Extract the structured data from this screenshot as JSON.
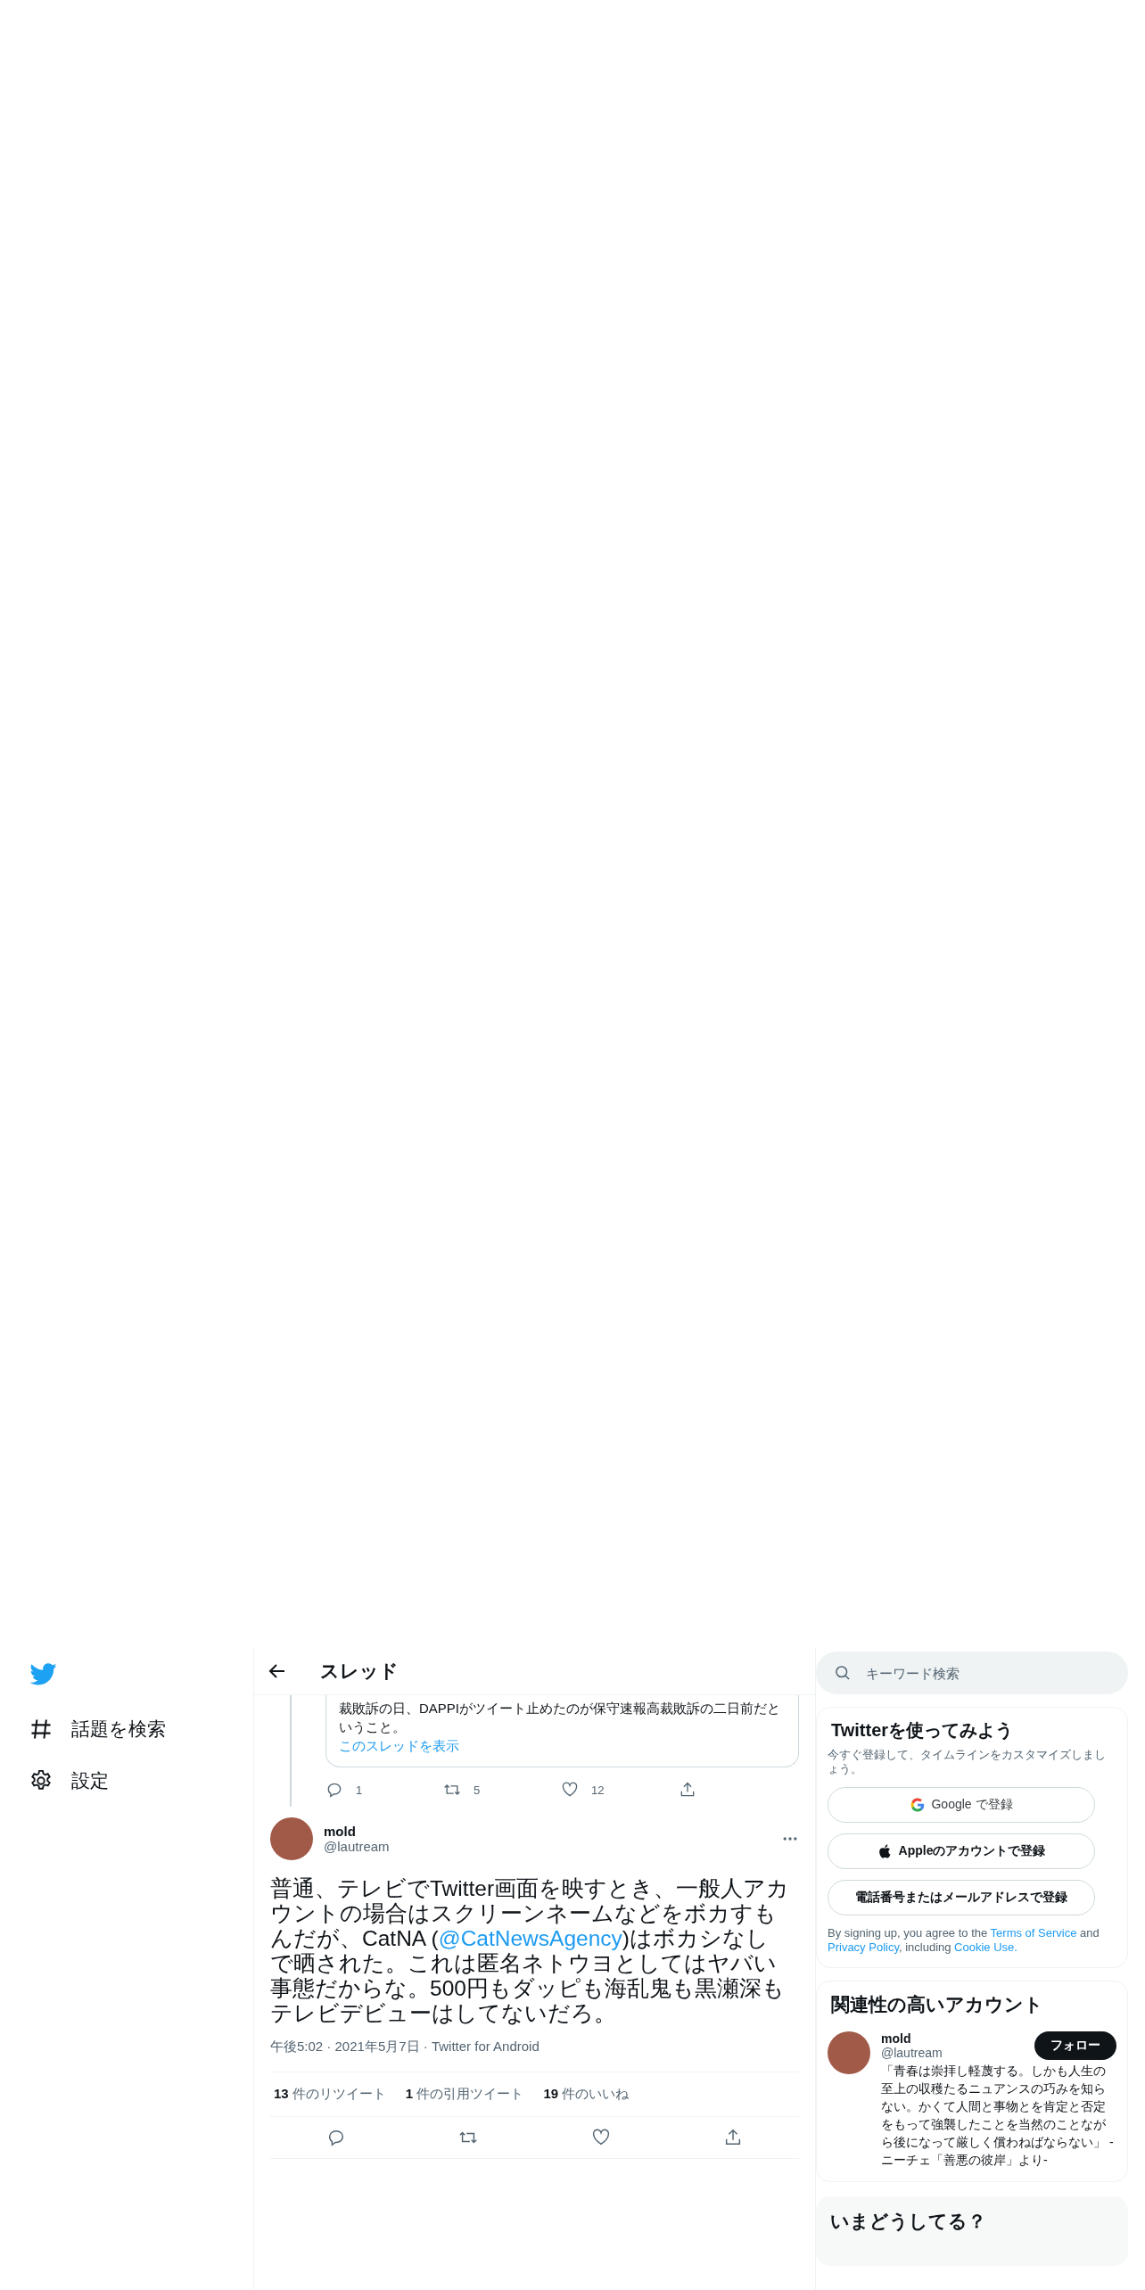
{
  "sidebar": {
    "items": [
      {
        "kind": "hashtag",
        "label": "話題を検索"
      },
      {
        "kind": "gear",
        "label": "設定"
      }
    ]
  },
  "header": {
    "title": "スレッド"
  },
  "quoted_card": {
    "text": "裁敗訴の日、DAPPIがツイート止めたのが保守速報高裁敗訴の二日前だということ。",
    "link": "このスレッドを表示"
  },
  "parent_actions": [
    {
      "kind": "reply",
      "count": "1"
    },
    {
      "kind": "retweet",
      "count": "5"
    },
    {
      "kind": "like",
      "count": "12"
    },
    {
      "kind": "share"
    }
  ],
  "tweet": {
    "name": "mold",
    "handle": "@lautream",
    "segments": [
      {
        "kind": "plain",
        "text": "普通、テレビでTwitter画面を映すとき、一般人アカウントの場合はスクリーンネームなどをボカすもんだが、CatNA ("
      },
      {
        "kind": "mention",
        "text": "@CatNewsAgency"
      },
      {
        "kind": "plain",
        "text": ")はボカシなしで晒された。これは匿名ネトウヨとしてはヤバい事態だからな。500円もダッピも海乱鬼も黒瀬深もテレビデビューはしてないだろ。"
      }
    ],
    "meta": "午後5:02 · 2021年5月7日 · Twitter for Android",
    "stats": [
      {
        "count": "13",
        "label": "件のリツイート"
      },
      {
        "count": "1",
        "label": "件の引用ツイート"
      },
      {
        "count": "19",
        "label": "件のいいね"
      }
    ],
    "actions": [
      {
        "kind": "reply"
      },
      {
        "kind": "retweet"
      },
      {
        "kind": "like"
      },
      {
        "kind": "share"
      }
    ]
  },
  "search": {
    "placeholder": "キーワード検索"
  },
  "signup": {
    "title": "Twitterを使ってみよう",
    "subtitle": "今すぐ登録して、タイムラインをカスタマイズしましょう。",
    "buttons": [
      {
        "kind": "google",
        "label": "Google で登録"
      },
      {
        "kind": "apple",
        "label": "Appleのアカウントで登録"
      },
      {
        "kind": "plain",
        "label": "電話番号またはメールアドレスで登録"
      }
    ],
    "legal": [
      {
        "kind": "plain",
        "text": "By signing up, you agree to the "
      },
      {
        "kind": "link",
        "text": "Terms of Service"
      },
      {
        "kind": "plain",
        "text": " and "
      },
      {
        "kind": "link",
        "text": "Privacy Policy"
      },
      {
        "kind": "plain",
        "text": ", including "
      },
      {
        "kind": "link",
        "text": "Cookie Use."
      }
    ]
  },
  "related": {
    "title": "関連性の高いアカウント",
    "name": "mold",
    "handle": "@lautream",
    "follow": "フォロー",
    "bio": "「青春は崇拝し軽蔑する。しかも人生の至上の収穫たるニュアンスの巧みを知らない。かくて人間と事物とを肯定と否定をもって強襲したことを当然のことながら後になって厳しく償わねばならない」 -ニーチェ「善悪の彼岸」より-"
  },
  "trends": {
    "title": "いまどうしてる？"
  }
}
